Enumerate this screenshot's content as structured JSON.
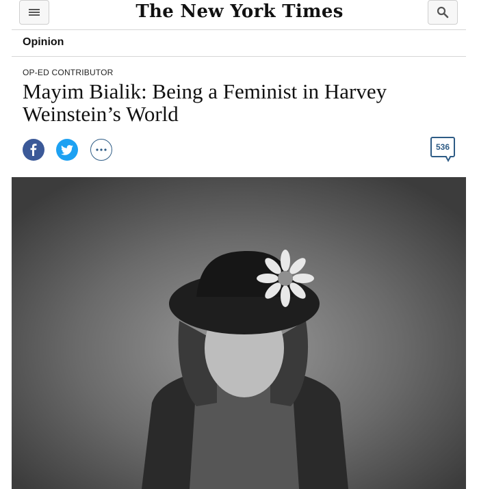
{
  "header": {
    "logo_text": "The New York Times",
    "menu_icon": "hamburger-menu-icon",
    "search_icon": "search-icon"
  },
  "section": {
    "label": "Opinion"
  },
  "article": {
    "kicker": "OP-ED CONTRIBUTOR",
    "headline": "Mayim Bialik: Being a Feminist in Harvey Weinstein’s World"
  },
  "share": {
    "facebook_icon": "facebook-icon",
    "twitter_icon": "twitter-icon",
    "more_icon": "more-options-icon"
  },
  "comments": {
    "count": "536"
  },
  "photo": {
    "alt_semantic": "portrait-photo"
  },
  "colors": {
    "facebook": "#3b5998",
    "twitter": "#1da1f2",
    "accent": "#2d5b85"
  }
}
